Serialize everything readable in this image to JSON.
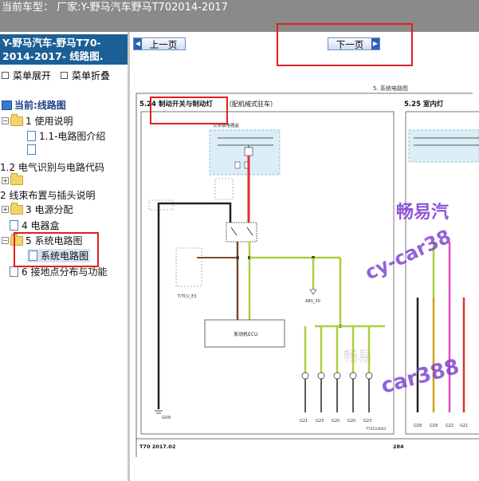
{
  "header": {
    "current_model": "当前车型： 厂家:Y-野马汽车野马T702014-2017"
  },
  "sidebar": {
    "title": "Y-野马汽车-野马T70-2014-2017- 线路图.",
    "expand_label": "菜单展开",
    "collapse_label": "菜单折叠",
    "tree": {
      "root_label": "当前:线路图",
      "item_1": "1 使用说明",
      "item_1_1": "1.1-电路图介绍",
      "item_1_2": "1.2 电气识别与电路代码",
      "item_2": "2 线束布置与插头说明",
      "item_3": "3 电源分配",
      "item_4": "4 电器盒",
      "item_5": "5 系统电路图",
      "item_5_1": "系统电路图",
      "item_6": "6 接地点分布与功能"
    }
  },
  "nav": {
    "prev_label": "上一页",
    "next_label": "下一页"
  },
  "diagram": {
    "section_header": "5. 系统电路图",
    "left_title": "5.24 制动开关与制动灯",
    "left_title_suffix": "（配机械式驻车）",
    "right_title": "5.25 室内灯",
    "panel_label": "仪表板电器盒",
    "ecu_label": "发动机ECU",
    "abs_label": "ABS_30",
    "tcu_label": "T/TCU_E3",
    "g09": "G09",
    "ground_labels": [
      "G21",
      "G23",
      "G20",
      "G20",
      "G23"
    ],
    "right_ground_labels": [
      "G18",
      "G18",
      "G22",
      "G21"
    ],
    "footer_left": "T70 2017.02",
    "page_number": "284",
    "diagram_code": "T70524001",
    "watermark_main": "畅易汽",
    "watermark_site": "cy-car38",
    "watermark_site2": "car388",
    "watermark_faint": "畅易"
  },
  "colors": {
    "red_highlight": "#e02020",
    "sidebar_title_bg": "#1c5f96",
    "watermark": "#7a3ad0",
    "wire_red": "#e03030",
    "wire_green": "#a8d23a",
    "wire_brown": "#7a4a2a",
    "wire_black": "#222222",
    "wire_pink": "#e050c0"
  }
}
